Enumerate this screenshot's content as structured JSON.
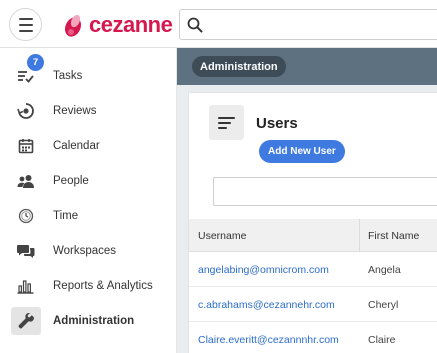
{
  "brand": {
    "name": "cezanne",
    "color": "#d6184f"
  },
  "search": {
    "placeholder": ""
  },
  "sidebar": {
    "tasks_badge": "7",
    "items": [
      {
        "label": "Tasks",
        "icon": "tasks-icon"
      },
      {
        "label": "Reviews",
        "icon": "reviews-icon"
      },
      {
        "label": "Calendar",
        "icon": "calendar-icon"
      },
      {
        "label": "People",
        "icon": "people-icon"
      },
      {
        "label": "Time",
        "icon": "time-icon"
      },
      {
        "label": "Workspaces",
        "icon": "workspaces-icon"
      },
      {
        "label": "Reports & Analytics",
        "icon": "reports-icon"
      },
      {
        "label": "Administration",
        "icon": "wrench-icon",
        "active": true
      }
    ]
  },
  "breadcrumb": {
    "label": "Administration"
  },
  "users": {
    "title": "Users",
    "add_button": "Add New User",
    "filter_placeholder": "",
    "columns": [
      "Username",
      "First Name"
    ],
    "rows": [
      {
        "username": "angelabing@omnicrom.com",
        "first_name": "Angela"
      },
      {
        "username": "c.abrahams@cezannehr.com",
        "first_name": "Cheryl"
      },
      {
        "username": "Claire.everitt@cezannnhr.com",
        "first_name": "Claire"
      }
    ]
  },
  "colors": {
    "accent": "#3f7ae0",
    "header_strip": "#5d7180",
    "pill": "#3d4c57",
    "link": "#2d6cc9"
  }
}
